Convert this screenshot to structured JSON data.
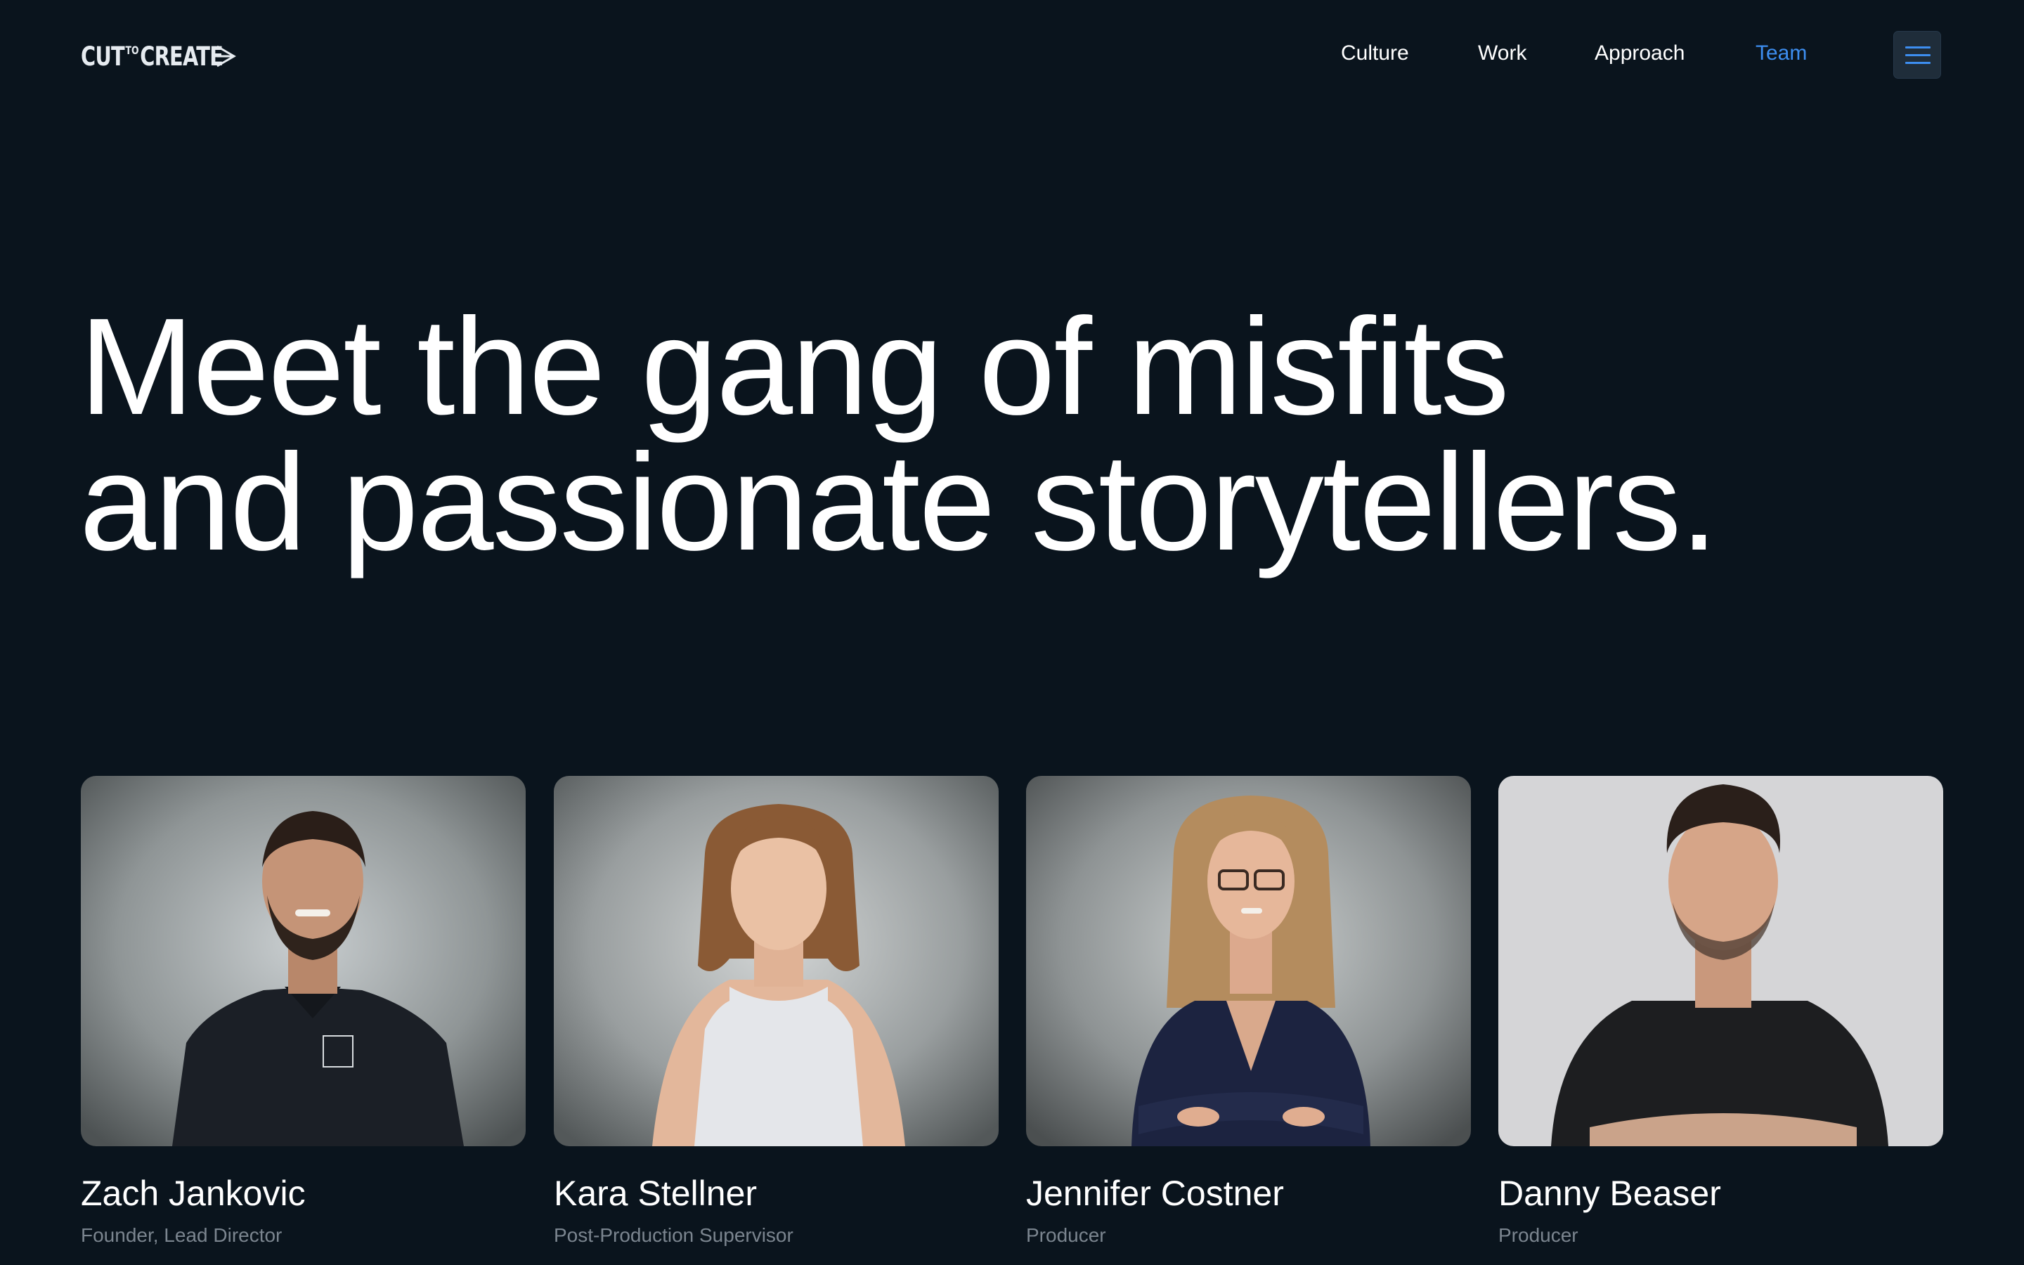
{
  "brand": {
    "logo_text": "CUT TO CREATE"
  },
  "nav": {
    "items": [
      "Culture",
      "Work",
      "Approach",
      "Team"
    ],
    "active": "Team",
    "menu_icon": "hamburger-icon"
  },
  "hero": {
    "line1": "Meet the gang of misfits",
    "line2": "and passionate storytellers."
  },
  "team": [
    {
      "name": "Zach Jankovic",
      "role": "Founder, Lead Director"
    },
    {
      "name": "Kara Stellner",
      "role": "Post-Production Supervisor"
    },
    {
      "name": "Jennifer Costner",
      "role": "Producer"
    },
    {
      "name": "Danny Beaser",
      "role": "Producer"
    }
  ],
  "colors": {
    "background": "#0a141d",
    "accent": "#3d8ef0",
    "text": "#ffffff",
    "muted": "#7b858f"
  }
}
